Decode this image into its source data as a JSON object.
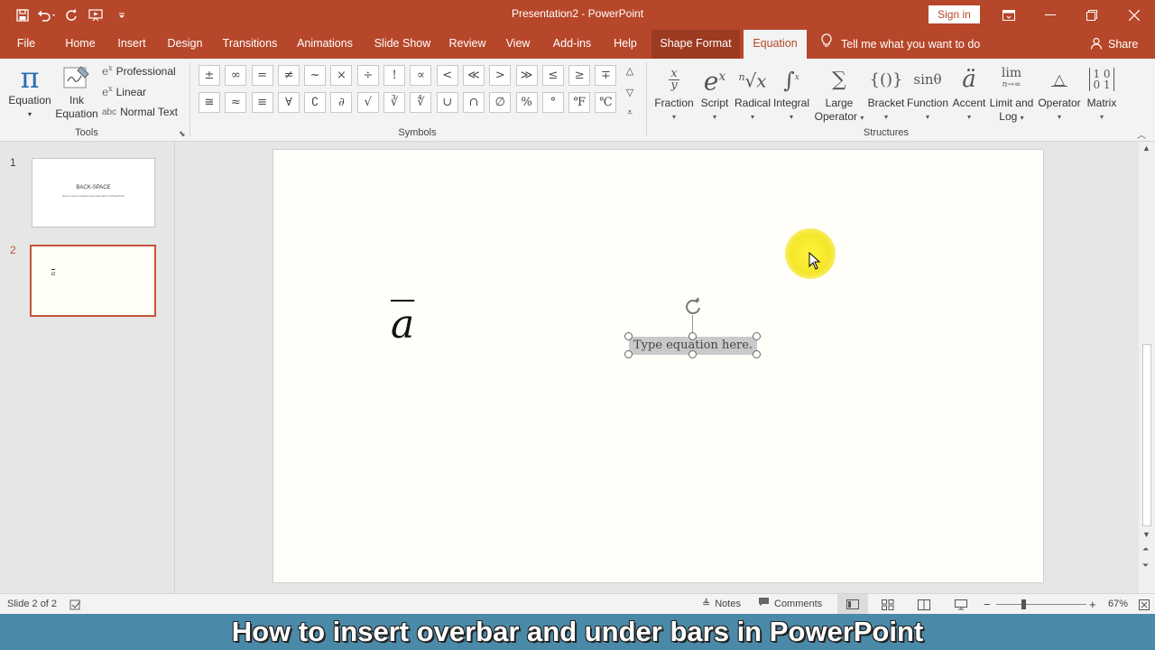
{
  "window": {
    "title": "Presentation2  -  PowerPoint",
    "signin_label": "Sign in",
    "accent": "#b7472a"
  },
  "tabs": [
    {
      "label": "File"
    },
    {
      "label": "Home"
    },
    {
      "label": "Insert"
    },
    {
      "label": "Design"
    },
    {
      "label": "Transitions"
    },
    {
      "label": "Animations"
    },
    {
      "label": "Slide Show"
    },
    {
      "label": "Review"
    },
    {
      "label": "View"
    },
    {
      "label": "Add-ins"
    },
    {
      "label": "Help"
    },
    {
      "label": "Shape Format"
    },
    {
      "label": "Equation"
    }
  ],
  "tellme": "Tell me what you want to do",
  "share_label": "Share",
  "ribbon": {
    "tools": {
      "group_label": "Tools",
      "equation": "Equation",
      "ink_equation_1": "Ink",
      "ink_equation_2": "Equation",
      "professional": "Professional",
      "linear": "Linear",
      "normal_text": "Normal Text"
    },
    "symbols": {
      "group_label": "Symbols",
      "items": [
        "±",
        "∞",
        "=",
        "≠",
        "~",
        "×",
        "÷",
        "!",
        "∝",
        "<",
        "≪",
        ">",
        "≫",
        "≤",
        "≥",
        "∓",
        "≅",
        "≈",
        "≡",
        "∀",
        "∁",
        "∂",
        "√",
        "∛",
        "∜",
        "∪",
        "∩",
        "∅",
        "%",
        "°",
        "℉",
        "℃"
      ]
    },
    "structures": {
      "group_label": "Structures",
      "items": [
        {
          "label": "Fraction",
          "label2": ""
        },
        {
          "label": "Script",
          "label2": ""
        },
        {
          "label": "Radical",
          "label2": ""
        },
        {
          "label": "Integral",
          "label2": ""
        },
        {
          "label": "Large",
          "label2": "Operator"
        },
        {
          "label": "Bracket",
          "label2": ""
        },
        {
          "label": "Function",
          "label2": ""
        },
        {
          "label": "Accent",
          "label2": ""
        },
        {
          "label": "Limit and",
          "label2": "Log"
        },
        {
          "label": "Operator",
          "label2": ""
        },
        {
          "label": "Matrix",
          "label2": ""
        }
      ]
    }
  },
  "thumbnails": [
    {
      "number": "1",
      "title": "BACK-SPACE",
      "subtitle": "How to insert overbar and under bars in PowerPoint"
    },
    {
      "number": "2",
      "content": "a"
    }
  ],
  "slide": {
    "overbar_char": "a",
    "equation_placeholder": "Type equation here."
  },
  "status": {
    "slide_info": "Slide 2 of 2",
    "notes": "Notes",
    "comments": "Comments",
    "zoom": "67%"
  },
  "caption": "How to insert overbar and under bars in PowerPoint"
}
